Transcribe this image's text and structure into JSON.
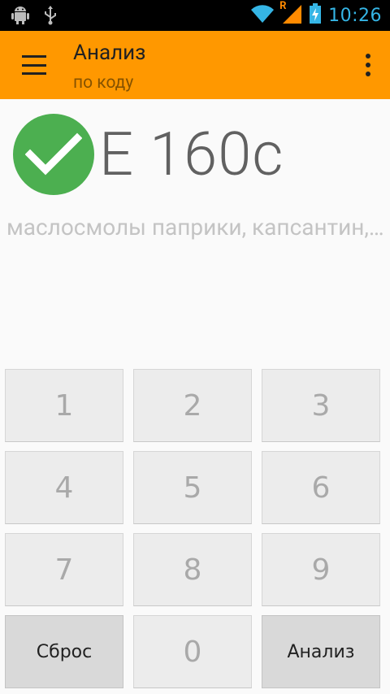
{
  "status_bar": {
    "time": "10:26",
    "signal_letter": "R",
    "icons": [
      "android-debug-icon",
      "usb-icon",
      "wifi-icon",
      "cell-signal-icon",
      "battery-charging-icon"
    ]
  },
  "app_bar": {
    "title": "Анализ",
    "subtitle": "по коду"
  },
  "result": {
    "status": "valid",
    "code": "E 160c",
    "description": "маслосмолы паприки, капсантин, капсорубин"
  },
  "keypad": {
    "keys": [
      "1",
      "2",
      "3",
      "4",
      "5",
      "6",
      "7",
      "8",
      "9"
    ],
    "reset_label": "Сброс",
    "zero_label": "0",
    "analyze_label": "Анализ"
  },
  "colors": {
    "accent": "#ff9800",
    "check": "#4caf50",
    "clock": "#35b5e5"
  }
}
